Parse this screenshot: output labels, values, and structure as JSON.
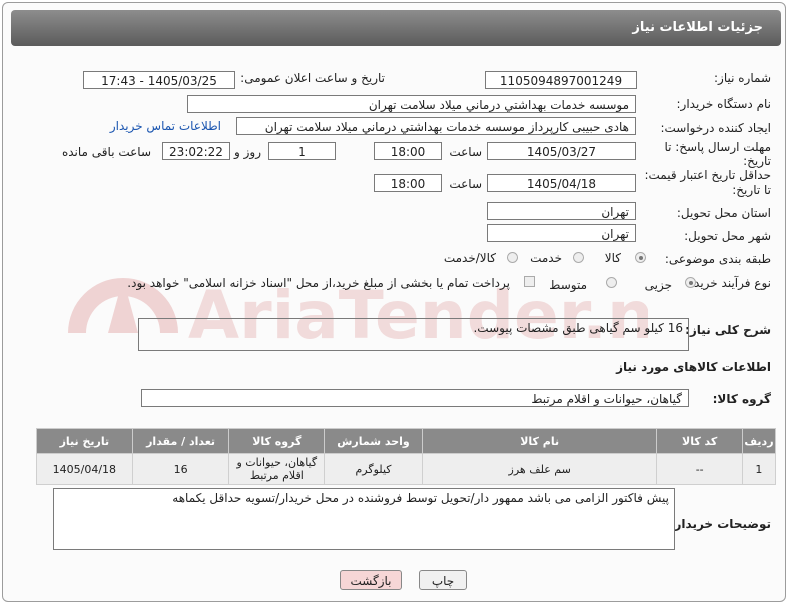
{
  "header": {
    "title": "جزئیات اطلاعات نیاز"
  },
  "fields": {
    "need_number_label": "شماره نیاز:",
    "need_number": "1105094897001249",
    "announce_label": "تاریخ و ساعت اعلان عمومی:",
    "announce_value": "1405/03/25 - 17:43",
    "buyer_org_label": "نام دستگاه خریدار:",
    "buyer_org": "موسسه خدمات بهداشتي درماني ميلاد سلامت تهران",
    "requester_label": "ایجاد کننده درخواست:",
    "requester": "هادی حبیبی کارپرداز موسسه خدمات بهداشتي درماني ميلاد سلامت تهران",
    "contact_link": "اطلاعات تماس خریدار",
    "deadline_label_1": "مهلت ارسال پاسخ: تا",
    "deadline_label_2": "تاریخ:",
    "deadline_date": "1405/03/27",
    "time_word": "ساعت",
    "deadline_time": "18:00",
    "days_value": "1",
    "days_word": "روز و",
    "remaining_time": "23:02:22",
    "remaining_word": "ساعت باقی مانده",
    "validity_label_1": "حداقل تاریخ اعتبار قیمت:",
    "validity_label_2": "تا تاریخ:",
    "validity_date": "1405/04/18",
    "validity_time": "18:00",
    "province_label": "استان محل تحویل:",
    "province": "تهران",
    "city_label": "شهر محل تحویل:",
    "city": "تهران",
    "category_label": "طبقه بندی موضوعی:",
    "category_options": [
      "کالا",
      "خدمت",
      "کالا/خدمت"
    ],
    "process_label": "نوع فرآیند خرید :",
    "process_options": [
      "جزیی",
      "متوسط"
    ],
    "treasury_text": "پرداخت تمام یا بخشی از مبلغ خرید،از محل \"اسناد خزانه اسلامی\" خواهد بود.",
    "description_label": "شرح کلی نیاز:",
    "description": "16 کیلو سم گیاهی طبق مشصات پیوست.",
    "goods_info_title": "اطلاعات کالاهای مورد نیاز",
    "goods_group_label": "گروه کالا:",
    "goods_group": "گیاهان، حیوانات و اقلام مرتبط",
    "buyer_notes_label": "توضیحات خریدار:",
    "buyer_notes": "پیش فاکتور الزامی می باشد ممهور دار/تحویل توسط فروشنده در محل خریدار/تسویه حداقل یکماهه"
  },
  "table": {
    "headers": [
      "ردیف",
      "کد کالا",
      "نام کالا",
      "واحد شمارش",
      "گروه کالا",
      "تعداد / مقدار",
      "تاریخ نیاز"
    ],
    "rows": [
      [
        "1",
        "--",
        "سم علف هرز",
        "کیلوگرم",
        "گیاهان، حیوانات و اقلام مرتبط",
        "16",
        "1405/04/18"
      ]
    ]
  },
  "buttons": {
    "print": "چاپ",
    "back": "بازگشت"
  },
  "watermark": "AriaTender.net",
  "colors": {
    "header_bg": "#6e6e6e",
    "table_header_bg": "#8a8a8a",
    "link": "#1a55b0",
    "back_button_bg": "#f6d6d6",
    "watermark": "#e3bcbc"
  }
}
